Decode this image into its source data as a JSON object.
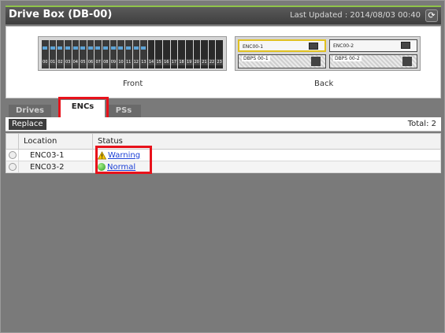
{
  "header": {
    "title": "Drive Box (DB-00)",
    "last_updated": "Last Updated : 2014/08/03 00:40",
    "refresh_icon": "refresh-icon"
  },
  "enclosure": {
    "front_label": "Front",
    "back_label": "Back",
    "slot_numbers": [
      "00",
      "01",
      "02",
      "03",
      "04",
      "05",
      "06",
      "07",
      "08",
      "09",
      "10",
      "11",
      "12",
      "13",
      "14",
      "15",
      "16",
      "17",
      "18",
      "19",
      "20",
      "21",
      "22",
      "23"
    ],
    "enc_left": "ENC00-1",
    "enc_right": "ENC00-2",
    "dbps_left": "DBPS 00-1",
    "dbps_right": "DBPS 00-2"
  },
  "tabs": [
    {
      "label": "Drives"
    },
    {
      "label": "ENCs"
    },
    {
      "label": "PSs"
    }
  ],
  "toolbar": {
    "replace_label": "Replace",
    "total_label": "Total: 2"
  },
  "table": {
    "columns": [
      "Location",
      "Status"
    ],
    "rows": [
      {
        "location": "ENC03-1",
        "status": "Warning",
        "status_icon": "warning-icon"
      },
      {
        "location": "ENC03-2",
        "status": "Normal",
        "status_icon": "normal-icon"
      }
    ]
  },
  "colors": {
    "title_accent": "#8fc34a",
    "highlight": "#e8121b",
    "link": "#1a3fd6"
  }
}
